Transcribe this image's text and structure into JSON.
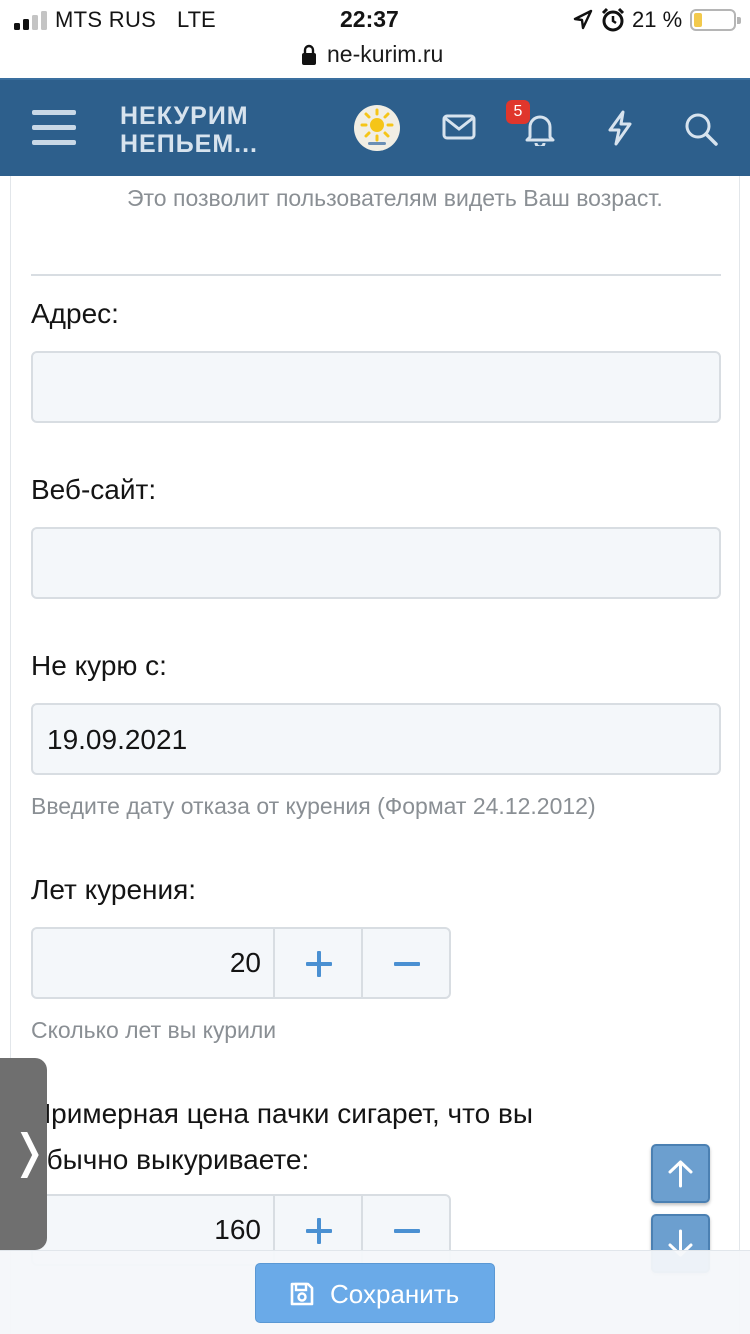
{
  "status_bar": {
    "carrier": "MTS RUS",
    "network": "LTE",
    "time": "22:37",
    "battery": "21 %",
    "battery_level": 0.21
  },
  "browser": {
    "url": "ne-kurim.ru"
  },
  "header": {
    "logo_line1": "НЕКУРИМ",
    "logo_line2": "НЕПЬЕМ...",
    "notification_count": "5",
    "colors": {
      "bar": "#2d5f8c",
      "badge": "#e0362c"
    }
  },
  "form": {
    "dob_hint": "Это позволит пользователям видеть Ваш возраст.",
    "address": {
      "label": "Адрес:",
      "value": ""
    },
    "website": {
      "label": "Веб-сайт:",
      "value": ""
    },
    "quit_date": {
      "label": "Не курю с:",
      "value": "19.09.2021",
      "hint": "Введите дату отказа от курения (Формат 24.12.2012)"
    },
    "years_smoking": {
      "label": "Лет курения:",
      "value": "20",
      "hint": "Сколько лет вы курили"
    },
    "pack_price": {
      "label_line1": "Примерная цена пачки сигарет, что вы",
      "label_line2": "обычно выкуриваете:",
      "value": "160"
    }
  },
  "side_tab": {
    "glyph": "❭"
  },
  "save_button": {
    "label": "Сохранить",
    "color": "#6aaae8"
  }
}
